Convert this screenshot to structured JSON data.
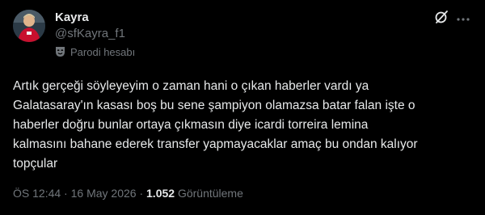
{
  "author": {
    "display_name": "Kayra",
    "handle": "@sfKayra_f1",
    "parody_label": "Parodi hesabı",
    "avatar_icon": "avatar-photo",
    "parody_icon": "theater-mask-icon"
  },
  "actions": {
    "grok_icon": "grok-icon",
    "more_icon": "more-dots-icon"
  },
  "tweet": {
    "text_lines": [
      "Artık gerçeği söyleyeyim o zaman hani o çıkan haberler vardı ya",
      "Galatasaray'ın kasası boş bu sene şampiyon olamazsa batar falan işte o",
      "haberler doğru bunlar ortaya çıkmasın diye icardi torreira lemina",
      "kalmasını bahane ederek transfer yapmayacaklar amaç bu ondan kalıyor",
      "topçular"
    ]
  },
  "meta": {
    "time": "ÖS 12:44",
    "separator": " · ",
    "date": "16 May 2026",
    "views_count": "1.052",
    "views_label": "Görüntüleme"
  },
  "colors": {
    "background": "#000000",
    "text_primary": "#e7e9ea",
    "text_secondary": "#71767b"
  }
}
